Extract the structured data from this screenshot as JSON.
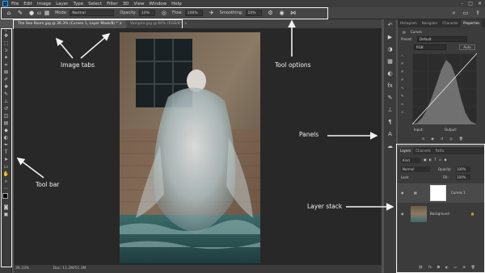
{
  "menu": {
    "logo": "Ps",
    "items": [
      "File",
      "Edit",
      "Image",
      "Layer",
      "Type",
      "Select",
      "Filter",
      "3D",
      "View",
      "Window",
      "Help"
    ]
  },
  "options": {
    "mode_label": "Mode:",
    "mode_value": "Normal",
    "opacity_label": "Opacity:",
    "opacity_value": "10%",
    "flow_label": "Flow:",
    "flow_value": "100%",
    "smoothing_label": "Smoothing:",
    "smoothing_value": "10%",
    "brush_size": "60"
  },
  "tabs": [
    {
      "label": "The Sea Room.jpg @ 36.3% (Curves 1, Layer Mask/8) * ×"
    },
    {
      "label": "Vampire.jpg @ 66% (RGB/8*) ×"
    }
  ],
  "status": {
    "zoom": "36.33%",
    "doc": "Doc: 11.2M/51.3M"
  },
  "properties": {
    "tabs": [
      "Histogram",
      "Navigator",
      "Character",
      "Properties"
    ],
    "title": "Curves",
    "preset_label": "Preset:",
    "preset_value": "Default",
    "channel_value": "RGB",
    "auto_label": "Auto",
    "input_label": "Input:",
    "output_label": "Output:"
  },
  "layers": {
    "tabs": [
      "Layers",
      "Channels",
      "Paths"
    ],
    "kind_value": "Kind",
    "blend_value": "Normal",
    "opacity_label": "Opacity:",
    "opacity_value": "100%",
    "lock_label": "Lock:",
    "fill_label": "Fill:",
    "fill_value": "100%",
    "items": [
      {
        "name": "Curves 1"
      },
      {
        "name": "Background"
      }
    ]
  },
  "annotations": {
    "image_tabs": "Image tabs",
    "tool_options": "Tool options",
    "panels": "Panels",
    "tool_bar": "Tool bar",
    "layer_stack": "Layer stack"
  },
  "colors": {
    "annotation": "#f2f2f2",
    "accent": "#31a8ff"
  }
}
